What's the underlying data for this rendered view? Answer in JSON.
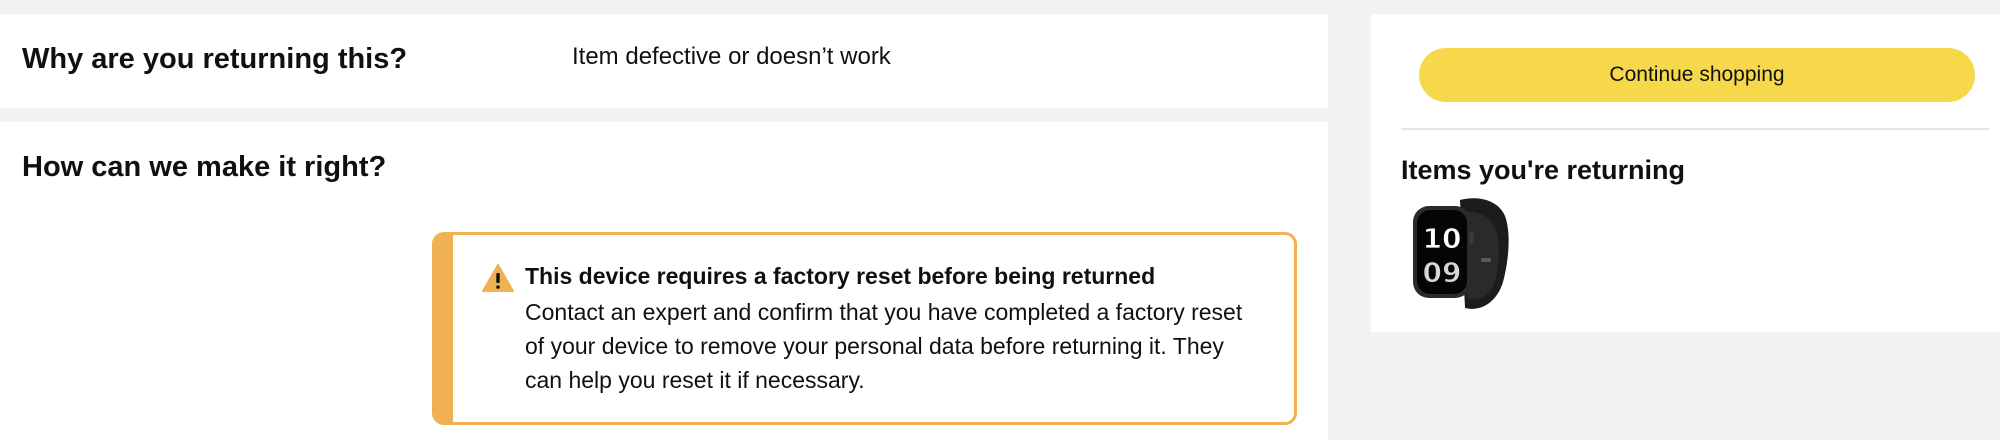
{
  "reason_section": {
    "heading": "Why are you returning this?",
    "answer": "Item defective or doesn’t work"
  },
  "resolution_section": {
    "heading": "How can we make it right?",
    "alert": {
      "icon": "warning-icon",
      "title": "This device requires a factory reset before being returned",
      "body": "Contact an expert and confirm that you have completed a factory reset of your device to remove your personal data before returning it. They can help you reset it if necessary."
    }
  },
  "sidebar": {
    "continue_label": "Continue shopping",
    "items_heading": "Items you're returning",
    "items": [
      {
        "icon": "smartwatch-thumbnail",
        "watch_face_text": "10 09"
      }
    ]
  },
  "colors": {
    "page_background": "#f2f2f2",
    "alert_accent": "#f0b153",
    "button_yellow": "#f8d84b",
    "text": "#0f1111"
  }
}
